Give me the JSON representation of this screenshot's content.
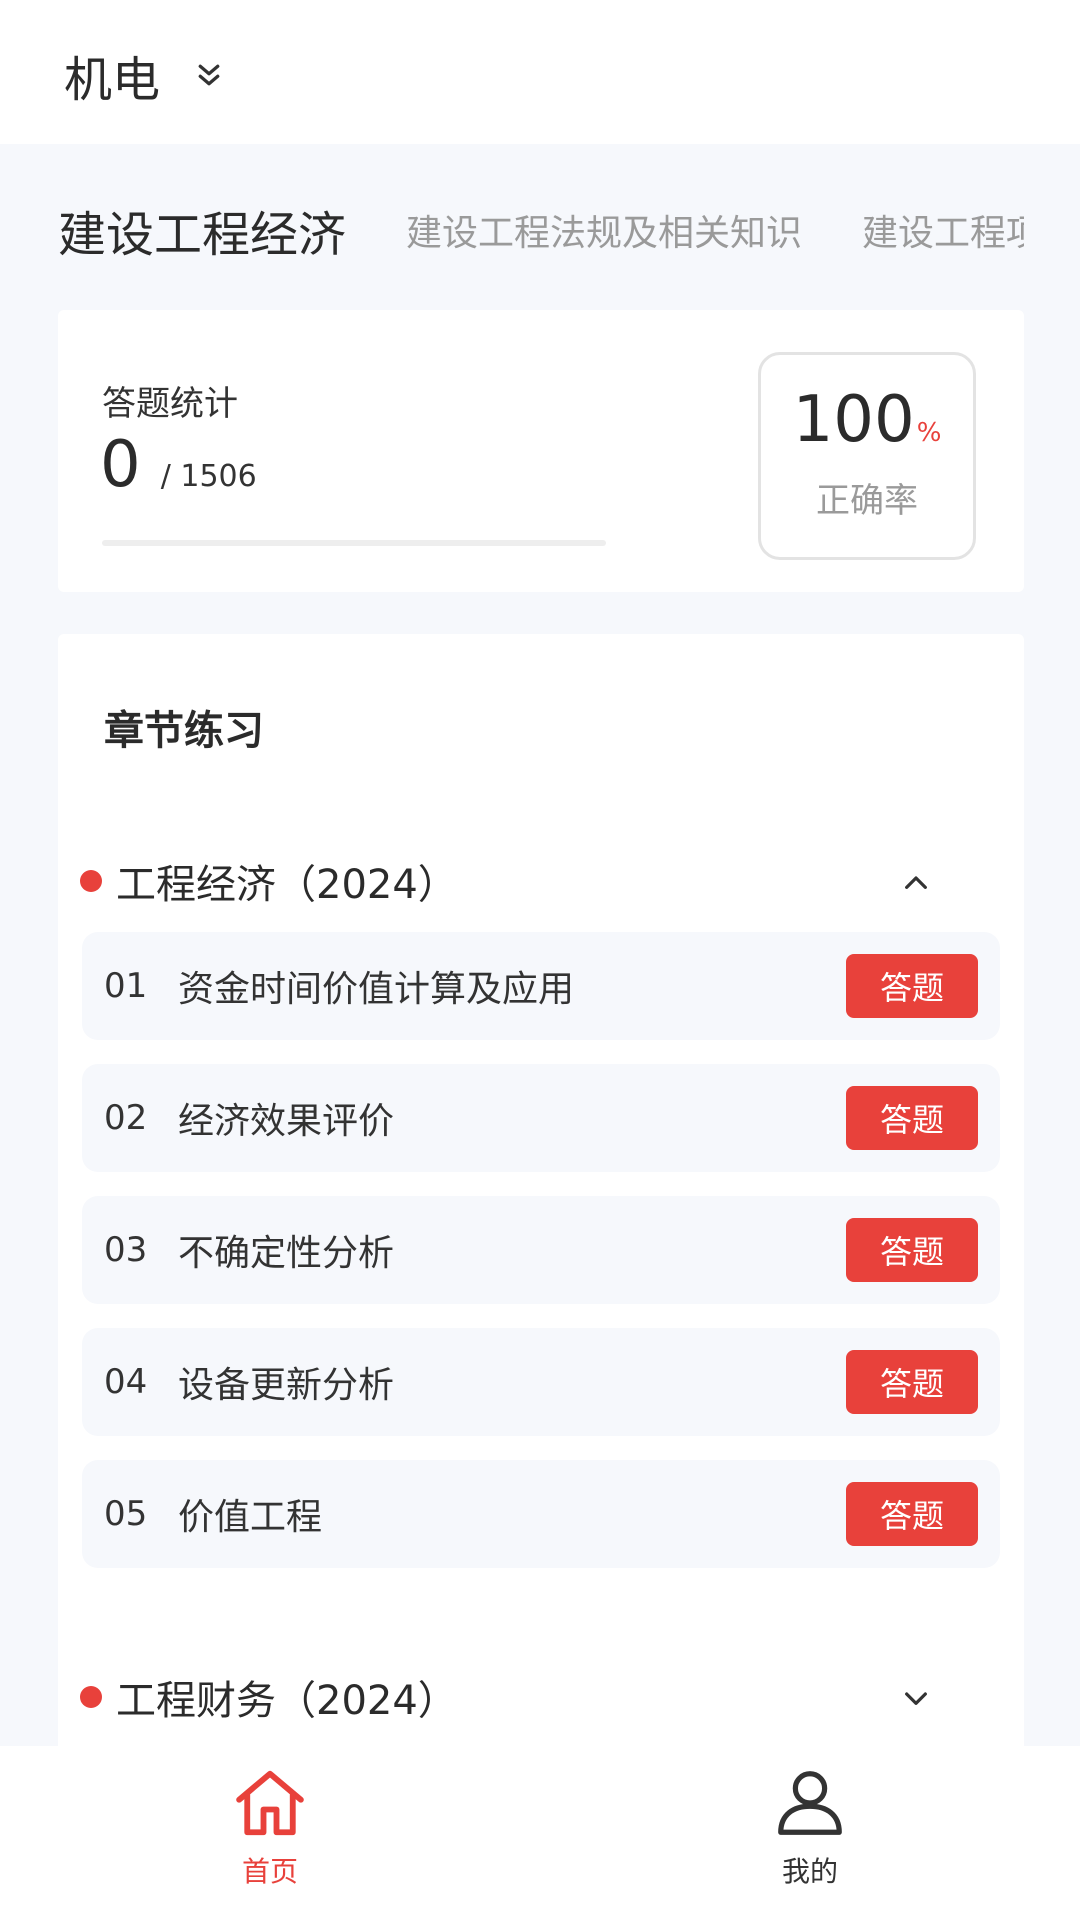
{
  "header": {
    "category": "机电"
  },
  "tabs": [
    {
      "label": "建设工程经济",
      "active": true
    },
    {
      "label": "建设工程法规及相关知识",
      "active": false
    },
    {
      "label": "建设工程项目管理",
      "active": false
    }
  ],
  "stats": {
    "title": "答题统计",
    "answered": "0",
    "total": "/ 1506",
    "progress_fraction": 0,
    "accuracy_value": "100",
    "accuracy_unit": "%",
    "accuracy_label": "正确率"
  },
  "chapters": {
    "heading": "章节练习",
    "groups": [
      {
        "title": "工程经济（2024）",
        "expanded": true,
        "items": [
          {
            "num": "01",
            "title": "资金时间价值计算及应用",
            "button": "答题"
          },
          {
            "num": "02",
            "title": "经济效果评价",
            "button": "答题"
          },
          {
            "num": "03",
            "title": "不确定性分析",
            "button": "答题"
          },
          {
            "num": "04",
            "title": "设备更新分析",
            "button": "答题"
          },
          {
            "num": "05",
            "title": "价值工程",
            "button": "答题"
          }
        ]
      },
      {
        "title": "工程财务（2024）",
        "expanded": false,
        "items": []
      }
    ]
  },
  "bottom_nav": [
    {
      "label": "首页",
      "icon": "home-icon",
      "active": true
    },
    {
      "label": "我的",
      "icon": "user-icon",
      "active": false
    }
  ],
  "colors": {
    "accent": "#e8413b",
    "background": "#f6f8fc"
  }
}
